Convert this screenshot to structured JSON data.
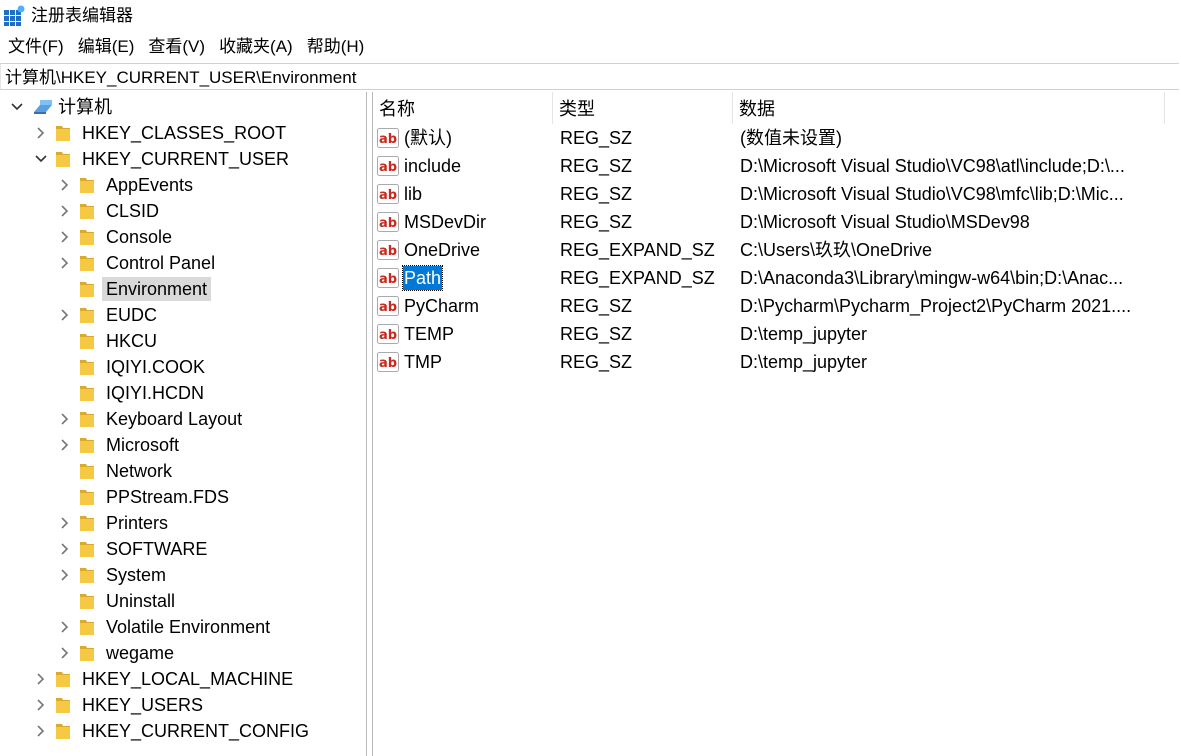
{
  "window": {
    "title": "注册表编辑器"
  },
  "menu": [
    "文件(F)",
    "编辑(E)",
    "查看(V)",
    "收藏夹(A)",
    "帮助(H)"
  ],
  "address": "计算机\\HKEY_CURRENT_USER\\Environment",
  "tree": {
    "root": "计算机",
    "items": [
      {
        "label": "HKEY_CLASSES_ROOT",
        "level": 1,
        "state": "collapsed"
      },
      {
        "label": "HKEY_CURRENT_USER",
        "level": 1,
        "state": "expanded"
      },
      {
        "label": "AppEvents",
        "level": 2,
        "state": "collapsed"
      },
      {
        "label": "CLSID",
        "level": 2,
        "state": "collapsed"
      },
      {
        "label": "Console",
        "level": 2,
        "state": "collapsed"
      },
      {
        "label": "Control Panel",
        "level": 2,
        "state": "collapsed"
      },
      {
        "label": "Environment",
        "level": 2,
        "state": "leaf",
        "selected": true
      },
      {
        "label": "EUDC",
        "level": 2,
        "state": "collapsed"
      },
      {
        "label": "HKCU",
        "level": 2,
        "state": "leaf"
      },
      {
        "label": "IQIYI.COOK",
        "level": 2,
        "state": "leaf"
      },
      {
        "label": "IQIYI.HCDN",
        "level": 2,
        "state": "leaf"
      },
      {
        "label": "Keyboard Layout",
        "level": 2,
        "state": "collapsed"
      },
      {
        "label": "Microsoft",
        "level": 2,
        "state": "collapsed"
      },
      {
        "label": "Network",
        "level": 2,
        "state": "leaf"
      },
      {
        "label": "PPStream.FDS",
        "level": 2,
        "state": "leaf"
      },
      {
        "label": "Printers",
        "level": 2,
        "state": "collapsed"
      },
      {
        "label": "SOFTWARE",
        "level": 2,
        "state": "collapsed"
      },
      {
        "label": "System",
        "level": 2,
        "state": "collapsed"
      },
      {
        "label": "Uninstall",
        "level": 2,
        "state": "leaf"
      },
      {
        "label": "Volatile Environment",
        "level": 2,
        "state": "collapsed"
      },
      {
        "label": "wegame",
        "level": 2,
        "state": "collapsed"
      },
      {
        "label": "HKEY_LOCAL_MACHINE",
        "level": 1,
        "state": "collapsed"
      },
      {
        "label": "HKEY_USERS",
        "level": 1,
        "state": "collapsed"
      },
      {
        "label": "HKEY_CURRENT_CONFIG",
        "level": 1,
        "state": "collapsed"
      }
    ]
  },
  "list": {
    "columns": [
      "名称",
      "类型",
      "数据"
    ],
    "rows": [
      {
        "name": "(默认)",
        "type": "REG_SZ",
        "data": "(数值未设置)"
      },
      {
        "name": "include",
        "type": "REG_SZ",
        "data": "D:\\Microsoft Visual Studio\\VC98\\atl\\include;D:\\..."
      },
      {
        "name": "lib",
        "type": "REG_SZ",
        "data": "D:\\Microsoft Visual Studio\\VC98\\mfc\\lib;D:\\Mic..."
      },
      {
        "name": "MSDevDir",
        "type": "REG_SZ",
        "data": "D:\\Microsoft Visual Studio\\MSDev98"
      },
      {
        "name": "OneDrive",
        "type": "REG_EXPAND_SZ",
        "data": "C:\\Users\\玖玖\\OneDrive"
      },
      {
        "name": "Path",
        "type": "REG_EXPAND_SZ",
        "data": "D:\\Anaconda3\\Library\\mingw-w64\\bin;D:\\Anac...",
        "selected": true
      },
      {
        "name": "PyCharm",
        "type": "REG_SZ",
        "data": "D:\\Pycharm\\Pycharm_Project2\\PyCharm 2021...."
      },
      {
        "name": "TEMP",
        "type": "REG_SZ",
        "data": "D:\\temp_jupyter"
      },
      {
        "name": "TMP",
        "type": "REG_SZ",
        "data": "D:\\temp_jupyter"
      }
    ]
  },
  "colors": {
    "selection": "#0078d7",
    "tree_selection": "#d9d9d9",
    "folder": "#e8b830",
    "ab_red": "#c8281e"
  }
}
